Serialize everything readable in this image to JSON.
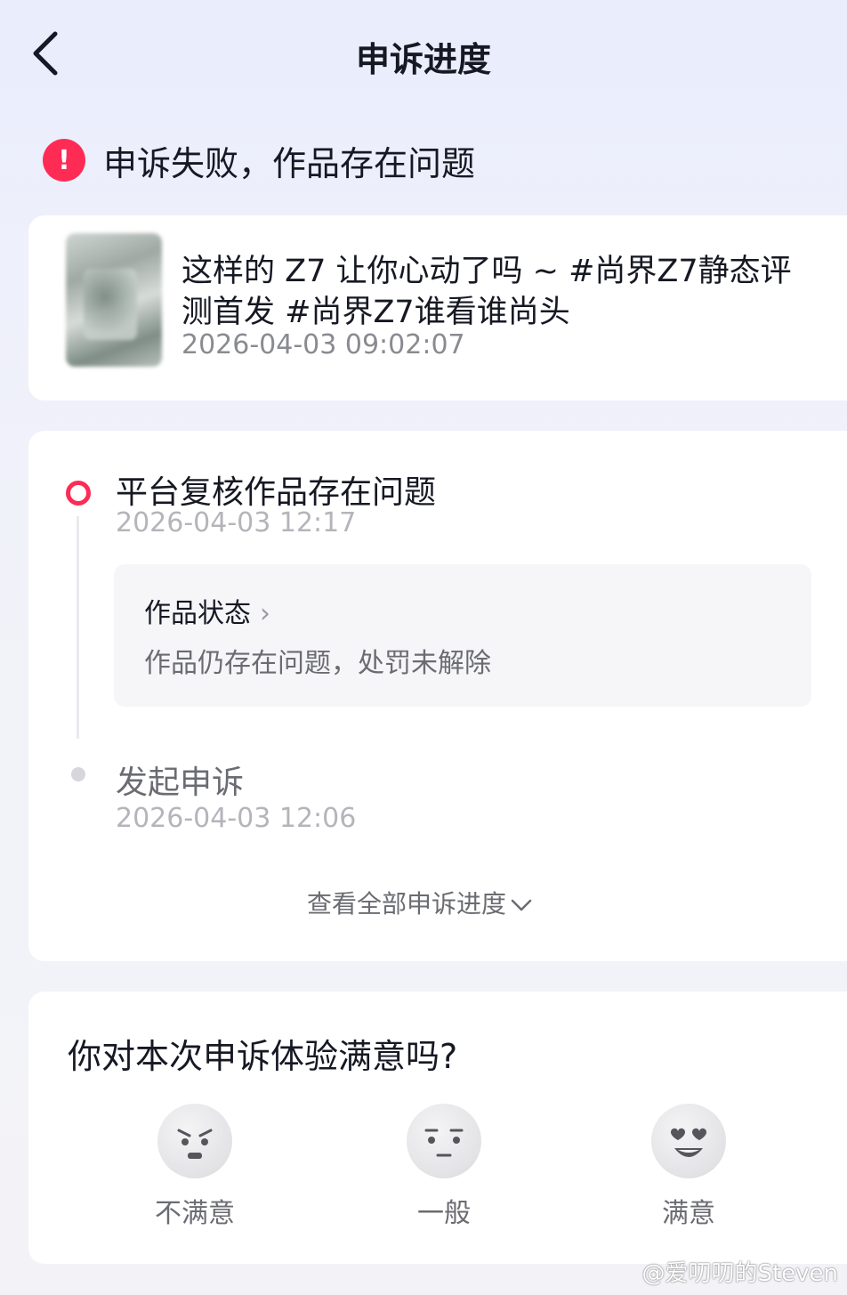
{
  "header": {
    "title": "申诉进度",
    "back_icon": "chevron-left-icon"
  },
  "status": {
    "icon": "exclamation-icon",
    "icon_glyph": "!",
    "text": "申诉失败，作品存在问题",
    "color": "#fe2c55"
  },
  "work": {
    "title": "这样的 Z7 让你心动了吗 ~ #尚界Z7静态评测首发 #尚界Z7谁看谁尚头",
    "time": "2026-04-03 09:02:07"
  },
  "timeline": {
    "steps": [
      {
        "title": "平台复核作品存在问题",
        "time": "2026-04-03 12:17"
      },
      {
        "title": "发起申诉",
        "time": "2026-04-03 12:06"
      }
    ],
    "status_box": {
      "title": "作品状态",
      "desc": "作品仍存在问题，处罚未解除"
    },
    "view_all": "查看全部申诉进度"
  },
  "satisfaction": {
    "question": "你对本次申诉体验满意吗?",
    "options": [
      {
        "label": "不满意",
        "icon": "angry-face-icon"
      },
      {
        "label": "一般",
        "icon": "neutral-face-icon"
      },
      {
        "label": "满意",
        "icon": "heart-eyes-face-icon"
      }
    ]
  },
  "watermark": "@爱叨叨的Steven"
}
